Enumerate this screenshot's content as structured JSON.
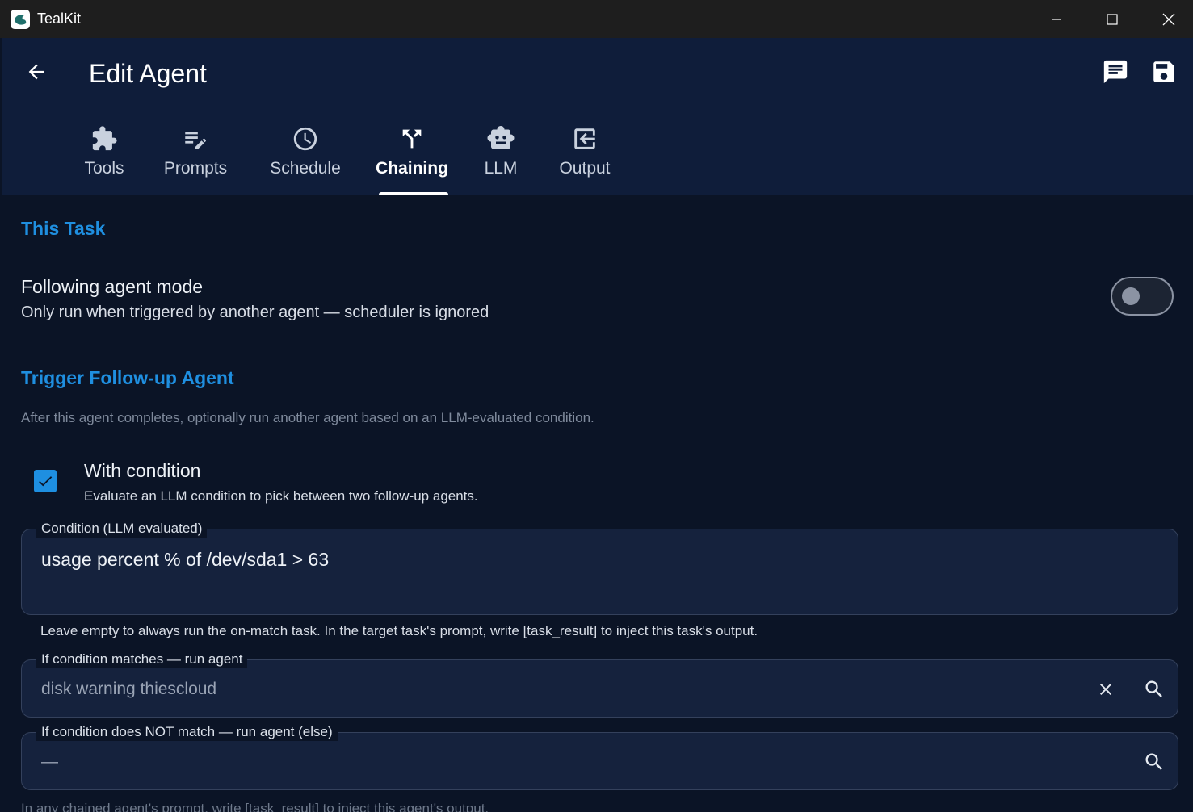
{
  "window": {
    "app_title": "TealKit"
  },
  "header": {
    "title": "Edit Agent"
  },
  "tabs": [
    {
      "label": "Tools",
      "icon": "puzzle-icon"
    },
    {
      "label": "Prompts",
      "icon": "edit-list-icon"
    },
    {
      "label": "Schedule",
      "icon": "clock-icon"
    },
    {
      "label": "Chaining",
      "icon": "fork-icon",
      "active": true
    },
    {
      "label": "LLM",
      "icon": "robot-icon"
    },
    {
      "label": "Output",
      "icon": "output-icon"
    }
  ],
  "this_task": {
    "heading": "This Task",
    "following_mode": {
      "title": "Following agent mode",
      "subtitle": "Only run when triggered by another agent — scheduler is ignored",
      "enabled": false
    }
  },
  "trigger": {
    "heading": "Trigger Follow-up Agent",
    "description": "After this agent completes, optionally run another agent based on an LLM-evaluated condition.",
    "with_condition": {
      "title": "With condition",
      "subtitle": "Evaluate an LLM condition to pick between two follow-up agents.",
      "checked": true
    },
    "condition_field": {
      "label": "Condition (LLM evaluated)",
      "value": "usage percent % of /dev/sda1 > 63",
      "helper": "Leave empty to always run the on-match task. In the target task's prompt, write [task_result] to inject this task's output."
    },
    "match_field": {
      "label": "If condition matches — run agent",
      "value": "disk warning thiescloud"
    },
    "else_field": {
      "label": "If condition does NOT match — run agent (else)",
      "value": "—",
      "helper": "In any chained agent's prompt, write [task_result] to inject this agent's output."
    }
  },
  "colors": {
    "accent": "#1f8fe0",
    "header_bg": "#0f1d3a",
    "content_bg": "#0b1426"
  }
}
